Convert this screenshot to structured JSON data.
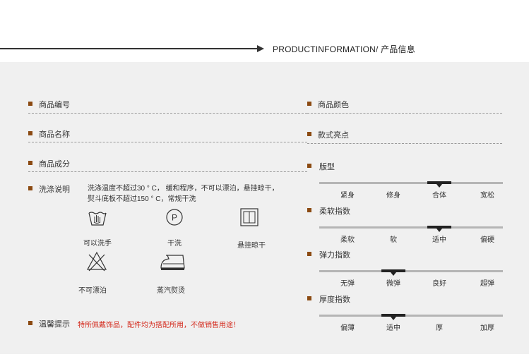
{
  "header": {
    "title": "PRODUCTINFORMATION/ 产品信息"
  },
  "left": {
    "fields": [
      {
        "label": "商品编号"
      },
      {
        "label": "商品名称"
      },
      {
        "label": "商品成分"
      }
    ],
    "wash": {
      "label": "洗涤说明",
      "line1": "洗涤温度不超过30 ° C，  缓和程序，不可以漂泊，悬挂晾干，",
      "line2": "熨斗底板不超过150 ° C，常规干洗"
    },
    "care_icons": [
      {
        "icon": "hand-wash-icon",
        "label": "可以洗手"
      },
      {
        "icon": "dry-clean-icon",
        "label": "干洗",
        "glyph": "P"
      },
      {
        "icon": "hang-dry-icon",
        "label": "悬挂晾干"
      },
      {
        "icon": "no-bleach-icon",
        "label": "不可漂泊"
      },
      {
        "icon": "steam-iron-icon",
        "label": "蒸汽熨烫"
      }
    ],
    "tip": {
      "label": "温馨提示",
      "text": "特所佩戴饰品，配件均为搭配所用，不做销售用途！"
    }
  },
  "right": {
    "fields": [
      {
        "label": "商品颜色"
      },
      {
        "label": "款式亮点"
      }
    ],
    "scales": [
      {
        "label": "版型",
        "options": [
          "紧身",
          "修身",
          "合体",
          "宽松"
        ],
        "selected_index": 2
      },
      {
        "label": "柔软指数",
        "options": [
          "柔软",
          "软",
          "适中",
          "偏硬"
        ],
        "selected_index": 2
      },
      {
        "label": "弹力指数",
        "options": [
          "无弹",
          "微弹",
          "良好",
          "超弹"
        ],
        "selected_index": 1
      },
      {
        "label": "厚度指数",
        "options": [
          "偏薄",
          "适中",
          "厚",
          "加厚"
        ],
        "selected_index": 1
      }
    ]
  },
  "colors": {
    "bullet": "#8b4a12",
    "tip_text": "#d42b1e",
    "panel_bg": "#f0f0f0"
  }
}
